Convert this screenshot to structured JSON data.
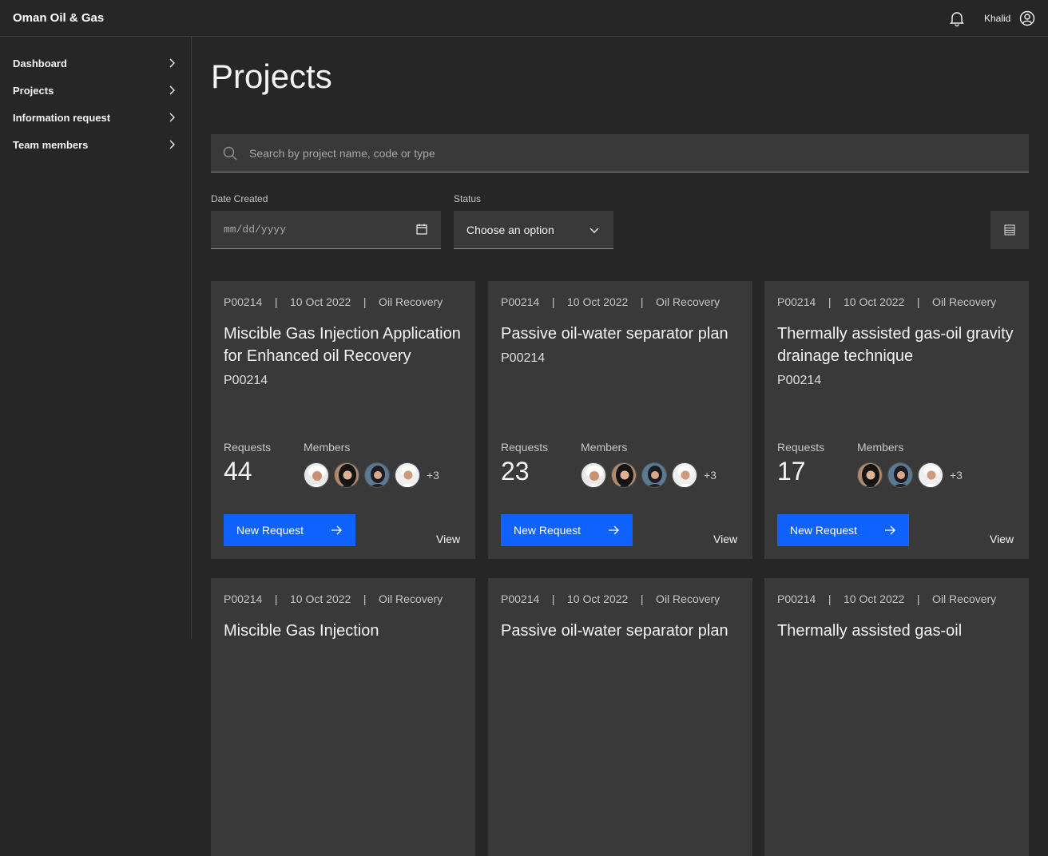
{
  "header": {
    "brand": "Oman Oil & Gas",
    "user": "Khalid"
  },
  "sidebar": {
    "items": [
      {
        "label": "Dashboard"
      },
      {
        "label": "Projects"
      },
      {
        "label": "Information request"
      },
      {
        "label": "Team members"
      }
    ]
  },
  "page": {
    "title": "Projects"
  },
  "search": {
    "placeholder": "Search by project name, code or type"
  },
  "filters": {
    "date_label": "Date Created",
    "date_placeholder": "mm/dd/yyyy",
    "status_label": "Status",
    "status_value": "Choose an option"
  },
  "cards": [
    {
      "meta": "P00214    |    10 Oct 2022    |    Oil Recovery",
      "title": "Miscible Gas Injection Application for Enhanced oil Recovery",
      "code": "P00214",
      "requests_label": "Requests",
      "requests": "44",
      "members_label": "Members",
      "more": "+3",
      "button": "New Request",
      "view": "View"
    },
    {
      "meta": "P00214    |    10 Oct 2022    |    Oil Recovery",
      "title": "Passive oil-water separator plan",
      "code": "P00214",
      "requests_label": "Requests",
      "requests": "23",
      "members_label": "Members",
      "more": "+3",
      "button": "New Request",
      "view": "View"
    },
    {
      "meta": "P00214    |    10 Oct 2022    |    Oil Recovery",
      "title": "Thermally assisted gas-oil gravity drainage technique",
      "code": "P00214",
      "requests_label": "Requests",
      "requests": "17",
      "members_label": "Members",
      "more": "+3",
      "button": "New Request",
      "view": "View"
    },
    {
      "meta": "P00214    |    10 Oct 2022    |    Oil Recovery",
      "title": "Miscible Gas Injection",
      "code": "",
      "requests_label": "",
      "requests": "",
      "members_label": "",
      "more": "",
      "button": "",
      "view": ""
    },
    {
      "meta": "P00214    |    10 Oct 2022    |    Oil Recovery",
      "title": "Passive oil-water separator plan",
      "code": "",
      "requests_label": "",
      "requests": "",
      "members_label": "",
      "more": "",
      "button": "",
      "view": ""
    },
    {
      "meta": "P00214    |    10 Oct 2022    |    Oil Recovery",
      "title": "Thermally assisted gas-oil",
      "code": "",
      "requests_label": "",
      "requests": "",
      "members_label": "",
      "more": "",
      "button": "",
      "view": ""
    }
  ],
  "colors": {
    "background": "#262626",
    "surface": "#393939",
    "primary": "#0f62fe",
    "text": "#f4f4f4"
  }
}
